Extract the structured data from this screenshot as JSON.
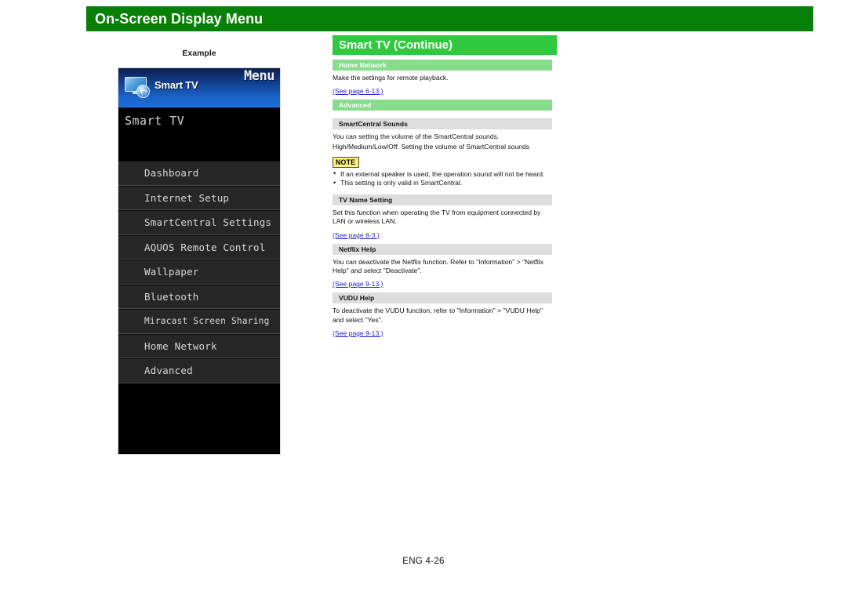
{
  "banner": {
    "title": "On-Screen Display Menu",
    "bg_color": "#068006"
  },
  "example": {
    "label": "Example",
    "tv_screen": {
      "header": {
        "menu_label": "Menu",
        "app_label": "Smart TV",
        "icon": "smart-tv-monitor-globe-icon"
      },
      "title": "Smart TV",
      "menu_items": [
        "Dashboard",
        "Internet Setup",
        "SmartCentral Settings",
        "AQUOS Remote Control",
        "Wallpaper",
        "Bluetooth",
        "Miracast Screen Sharing",
        "Home Network",
        "Advanced"
      ]
    }
  },
  "content": {
    "section_title": "Smart TV (Continue)",
    "title_bar_color": "#2ec93c",
    "green_head_color": "#88dd8c",
    "gray_head_color": "#dddddd",
    "link_color": "#2222cc",
    "home_network": {
      "heading": "Home Network",
      "body": "Make the settings for remote playback.",
      "link": "(See page 6-13.)"
    },
    "advanced": {
      "heading": "Advanced"
    },
    "smartcentral_sounds": {
      "heading": "SmartCentral Sounds",
      "body_line1": "You can setting the volume of the SmartCentral sounds.",
      "body_line2": "High/Medium/Low/Off: Setting the volume of SmartCentral sounds",
      "note_label": "NOTE",
      "notes": [
        "If an external speaker is used, the operation sound will not be heard.",
        "This setting is only valid in SmartCentral."
      ]
    },
    "tv_name_setting": {
      "heading": "TV Name Setting",
      "body": "Set this function when operating the TV from equipment connected by LAN or wireless LAN.",
      "link": "(See page 8-3.)"
    },
    "netflix_help": {
      "heading": "Netflix Help",
      "body": "You can deactivate the Netflix function. Refer to \"Information\" > \"Netflix Help\" and select \"Deactivate\".",
      "link": "(See page 9-13.)"
    },
    "vudu_help": {
      "heading": "VUDU Help",
      "body": "To deactivate the VUDU function, refer to \"Information\" > \"VUDU Help\" and select \"Yes\".",
      "link": "(See page 9-13.)"
    }
  },
  "footer": {
    "text": "ENG 4-26"
  }
}
